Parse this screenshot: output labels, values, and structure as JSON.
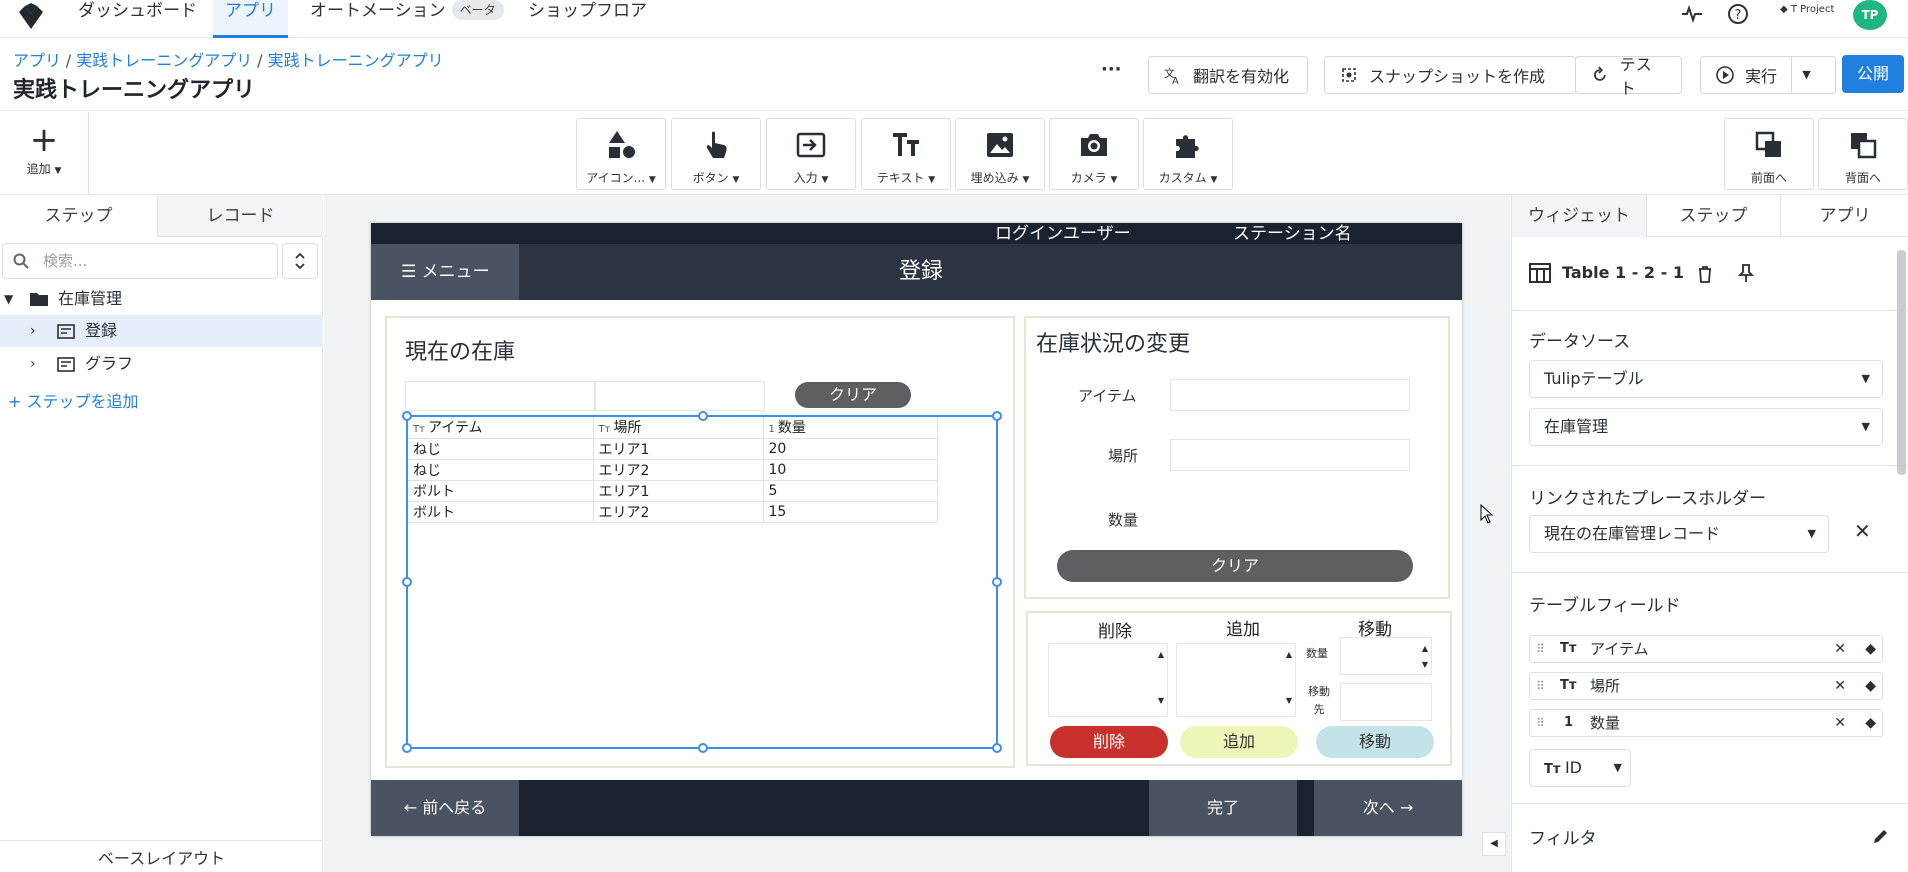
{
  "nav": {
    "items": [
      "ダッシュボード",
      "アプリ",
      "オートメーション",
      "ショップフロア"
    ],
    "beta": "ベータ",
    "project": "T Project",
    "avatar": "TP"
  },
  "header": {
    "breadcrumb": [
      "アプリ",
      "実践トレーニングアプリ",
      "実践トレーニングアプリ"
    ],
    "title": "実践トレーニングアプリ",
    "more": "···",
    "translate": "翻訳を有効化",
    "snapshot": "スナップショットを作成",
    "test": "テスト",
    "run": "実行",
    "publish": "公開"
  },
  "toolbar": {
    "add": "追加",
    "tools": [
      "アイコン...",
      "ボタン",
      "入力",
      "テキスト",
      "埋め込み",
      "カメラ",
      "カスタム"
    ],
    "front": "前面へ",
    "back": "背面へ"
  },
  "left": {
    "tabs": [
      "ステップ",
      "レコード"
    ],
    "search_placeholder": "検索...",
    "group": "在庫管理",
    "steps": [
      "登録",
      "グラフ"
    ],
    "add_step": "+ ステップを追加",
    "base_layout": "ベースレイアウト"
  },
  "app": {
    "login_user": "ログインユーザー",
    "station": "ステーション名",
    "menu": "メニュー",
    "title": "登録",
    "inventory_title": "現在の在庫",
    "clear": "クリア",
    "table_headers": [
      "アイテム",
      "場所",
      "数量"
    ],
    "table_types": [
      "Tт",
      "Tт",
      "1"
    ],
    "rows": [
      [
        "ねじ",
        "エリア1",
        "20"
      ],
      [
        "ねじ",
        "エリア2",
        "10"
      ],
      [
        "ボルト",
        "エリア1",
        "5"
      ],
      [
        "ボルト",
        "エリア2",
        "15"
      ]
    ],
    "change_title": "在庫状況の変更",
    "item_label": "アイテム",
    "place_label": "場所",
    "qty_label": "数量",
    "clear2": "クリア",
    "ops": [
      "削除",
      "追加",
      "移動"
    ],
    "move_qty": "数量",
    "move_to_1": "移動",
    "move_to_2": "先",
    "btn_delete": "削除",
    "btn_add": "追加",
    "btn_move": "移動",
    "back": "前へ戻る",
    "done": "完了",
    "next": "次へ"
  },
  "right": {
    "tabs": [
      "ウィジェット",
      "ステップ",
      "アプリ"
    ],
    "widget_name": "Table 1 - 2 - 1",
    "datasource_label": "データソース",
    "datasource": "Tulipテーブル",
    "table": "在庫管理",
    "linked_label": "リンクされたプレースホルダー",
    "linked": "現在の在庫管理レコード",
    "fields_label": "テーブルフィールド",
    "fields": [
      {
        "type": "Tт",
        "name": "アイテム"
      },
      {
        "type": "Tт",
        "name": "場所"
      },
      {
        "type": "1",
        "name": "数量"
      }
    ],
    "id_field": "ID",
    "filter_label": "フィルタ"
  },
  "colors": {
    "accent": "#1f80e0",
    "delete": "#c8302b",
    "add": "#eef5b6",
    "move": "#c3e3e8"
  }
}
